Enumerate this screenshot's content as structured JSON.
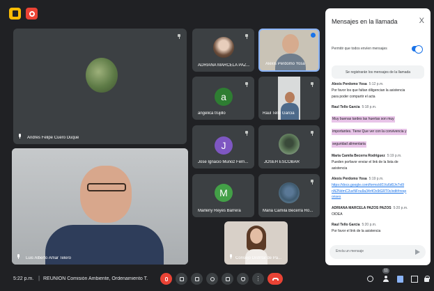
{
  "top_controls": {
    "activities_icon": "activities-icon",
    "record_icon": "record-icon"
  },
  "tiles": {
    "andres": {
      "name": "Andres Felipe Cuero Duque"
    },
    "luis": {
      "name": "Luis Alberto Amar Telero"
    },
    "adriana": {
      "name": "ADRIANA MARCELA PAZ..."
    },
    "alexis": {
      "name": "Alexis Perdomo Yosa"
    },
    "angelica": {
      "name": "angelica trujillo",
      "initial": "a",
      "color": "#2e7d32"
    },
    "raul": {
      "name": "Raul Tello Garcia"
    },
    "jose": {
      "name": "Jose Ignacio Muñoz Fern...",
      "initial": "J",
      "color": "#7e57c2"
    },
    "joseh": {
      "name": "JOSEH ESCOBAR"
    },
    "marleny": {
      "name": "Marleny Reyes Barrera",
      "initial": "M",
      "color": "#43a047"
    },
    "mariacamila": {
      "name": "Maria Camila Becerra Ro..."
    },
    "consejo": {
      "name": "Consejo Distrital de Pa..."
    }
  },
  "chat": {
    "title": "Mensajes en la llamada",
    "close": "X",
    "allow_label": "Permitir que todos envíen mensajes",
    "notice": "Se registrarán los mensajes de la llamada",
    "messages": [
      {
        "sender": "Alexis Perdomo Yosa",
        "time": "5:12 p.m.",
        "lines": [
          "Por favor los  que faltan diligencian la asistencia",
          "para poder compartir el acta"
        ]
      },
      {
        "sender": "Raul Tello Garcia",
        "time": "5:18 p.m.",
        "lines": [
          "Muy buenas tardes las huertas son muy",
          "importantes. Tiene Que ver con la convivencia y",
          "seguridad alimentaria"
        ]
      },
      {
        "sender": "Maria Camila Becerra Rodriguez",
        "time": "5:19 p.m.",
        "lines": [
          "Pueden porfavor enviar el link de la lista de",
          "asistencia"
        ]
      },
      {
        "sender": "Alexis Perdomo Yosa",
        "time": "5:19 p.m.",
        "lines": [
          "https://docs.google.com/forms/d/1Vu6d0Jn7xt9",
          "nN2NdmC2uvNFnu9a34r4Ox9iGRT0c/edit#resp",
          "onses"
        ]
      },
      {
        "sender": "ADRIANA MARCELA PAZOS PAZOS",
        "time": "5:20 p.m.",
        "lines": [
          "OIDEA"
        ]
      },
      {
        "sender": "Raul Tello Garcia",
        "time": "5:20 p.m.",
        "lines": [
          "Por favor el link de la asistencia"
        ]
      }
    ],
    "input_placeholder": "Envía un mensaje"
  },
  "bottom_bar": {
    "time": "5:22 p.m.",
    "separator": "|",
    "meeting_title": "REUNION Comisión Ambiente, Ordenamiento T...",
    "people_count": "11"
  },
  "colors": {
    "accent": "#1a73e8",
    "danger": "#ea4335",
    "background": "#202124",
    "tile": "#3c4043"
  }
}
